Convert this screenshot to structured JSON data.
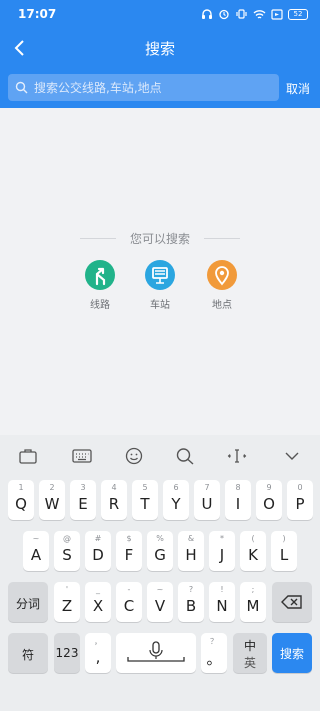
{
  "status_bar": {
    "time": "17:07",
    "battery": "52"
  },
  "header": {
    "title": "搜索"
  },
  "search": {
    "placeholder": "搜索公交线路,车站,地点",
    "cancel_label": "取消"
  },
  "content": {
    "hint": "您可以搜索",
    "options": [
      {
        "label": "线路",
        "icon": "route-icon",
        "color": "#21b38a"
      },
      {
        "label": "车站",
        "icon": "bus-stop-icon",
        "color": "#2ba6e0"
      },
      {
        "label": "地点",
        "icon": "location-pin-icon",
        "color": "#f19a3a"
      }
    ]
  },
  "keyboard": {
    "toolbar": [
      "briefcase-icon",
      "keyboard-icon",
      "emoji-icon",
      "search-icon",
      "cursor-icon",
      "collapse-icon"
    ],
    "row1": [
      {
        "main": "Q",
        "sup": "1"
      },
      {
        "main": "W",
        "sup": "2"
      },
      {
        "main": "E",
        "sup": "3"
      },
      {
        "main": "R",
        "sup": "4"
      },
      {
        "main": "T",
        "sup": "5"
      },
      {
        "main": "Y",
        "sup": "6"
      },
      {
        "main": "U",
        "sup": "7"
      },
      {
        "main": "I",
        "sup": "8"
      },
      {
        "main": "O",
        "sup": "9"
      },
      {
        "main": "P",
        "sup": "0"
      }
    ],
    "row2": [
      {
        "main": "A",
        "sup": "~"
      },
      {
        "main": "S",
        "sup": "@"
      },
      {
        "main": "D",
        "sup": "#"
      },
      {
        "main": "F",
        "sup": "$"
      },
      {
        "main": "G",
        "sup": "%"
      },
      {
        "main": "H",
        "sup": "&"
      },
      {
        "main": "J",
        "sup": "*"
      },
      {
        "main": "K",
        "sup": "("
      },
      {
        "main": "L",
        "sup": ")"
      }
    ],
    "row3": [
      {
        "main": "Z",
        "sup": "'"
      },
      {
        "main": "X",
        "sup": "_"
      },
      {
        "main": "C",
        "sup": "-"
      },
      {
        "main": "V",
        "sup": "~"
      },
      {
        "main": "B",
        "sup": "?"
      },
      {
        "main": "N",
        "sup": "!"
      },
      {
        "main": "M",
        "sup": ";"
      }
    ],
    "fenci": "分词",
    "fu": "符",
    "num": "123",
    "comma": ",",
    "comma_sup": "，",
    "period": "。",
    "period_sup": "？",
    "lang_top": "中",
    "lang_bottom": "英",
    "search_key": "搜索"
  }
}
